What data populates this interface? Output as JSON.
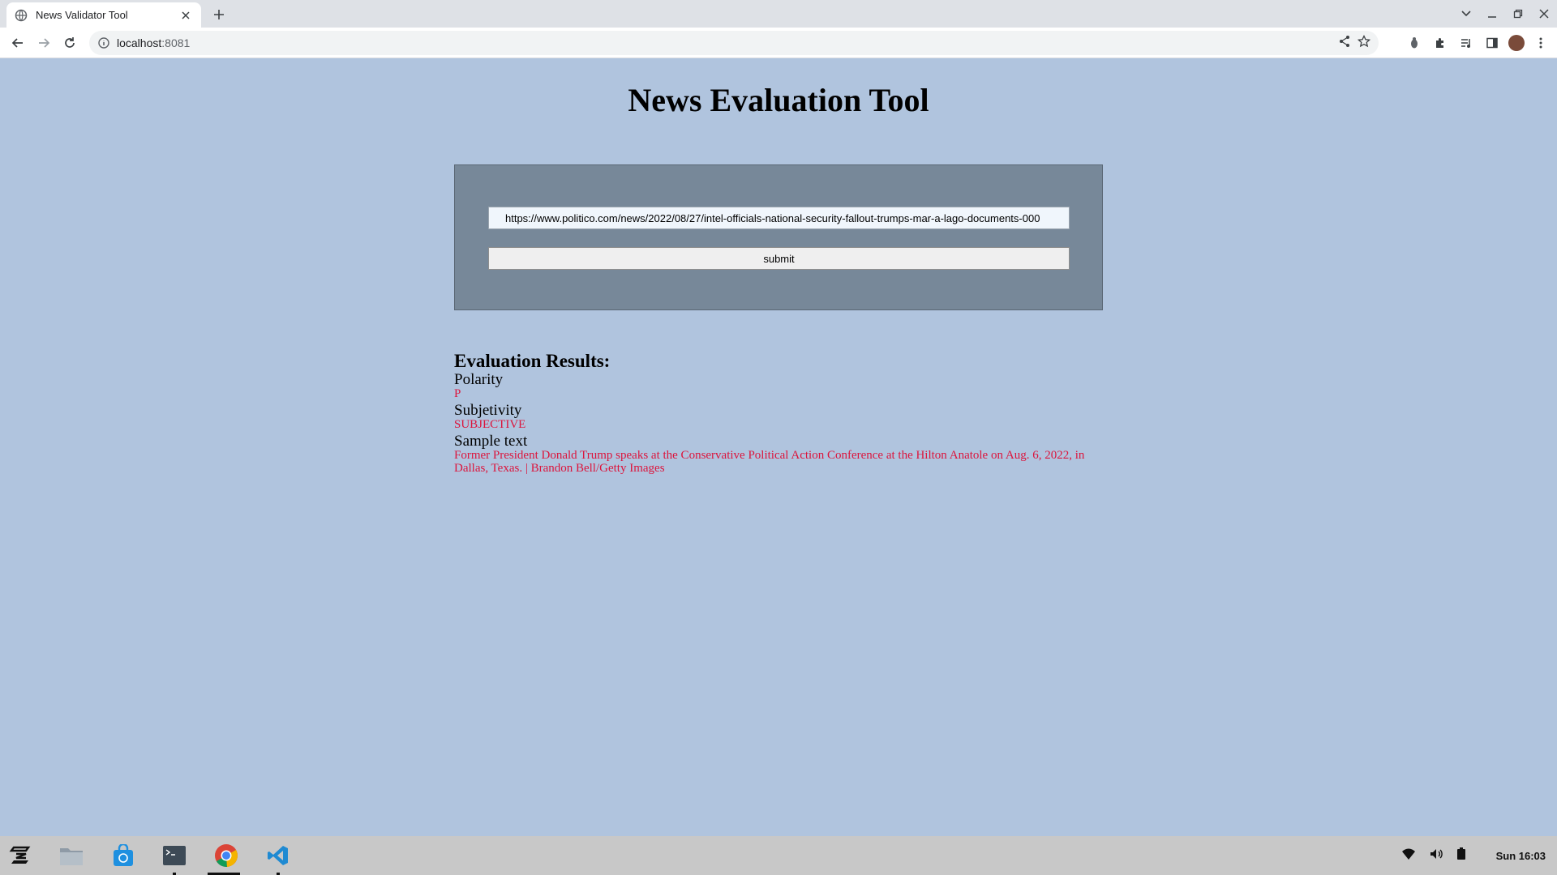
{
  "browser": {
    "tab_title": "News Validator Tool",
    "url_host": "localhost",
    "url_port": ":8081"
  },
  "page": {
    "title": "News Evaluation Tool",
    "form": {
      "url_value": "https://www.politico.com/news/2022/08/27/intel-officials-national-security-fallout-trumps-mar-a-lago-documents-000",
      "submit_label": "submit"
    },
    "results": {
      "heading": "Evaluation Results:",
      "polarity_label": "Polarity",
      "polarity_value": "P",
      "subjectivity_label": "Subjetivity",
      "subjectivity_value": "SUBJECTIVE",
      "sample_label": "Sample text",
      "sample_value": "Former President Donald Trump speaks at the Conservative Political Action Conference at the Hilton Anatole on Aug. 6, 2022, in Dallas, Texas. | Brandon Bell/Getty Images"
    }
  },
  "taskbar": {
    "clock": "Sun 16:03",
    "apps": [
      "zorin-menu-icon",
      "files-icon",
      "software-store-icon",
      "terminal-icon",
      "chrome-icon",
      "vscode-icon"
    ]
  },
  "colors": {
    "page_background": "#b0c4de",
    "form_background": "#778899",
    "result_value": "#dc143c"
  }
}
